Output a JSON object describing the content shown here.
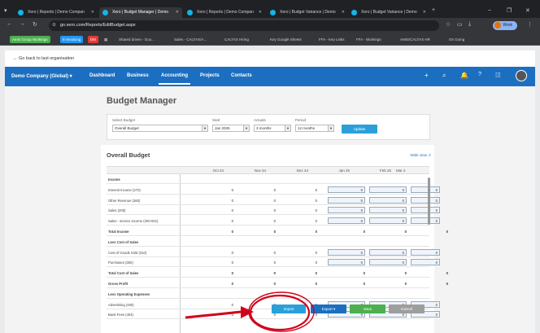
{
  "browser": {
    "tabs": [
      {
        "label": "Xero | Reports | Demo Compan"
      },
      {
        "label": "Xero | Budget Manager | Demo"
      },
      {
        "label": "Xero | Reports | Demo Compan"
      },
      {
        "label": "Xero | Budget Variance | Demo"
      },
      {
        "label": "Xero | Budget Variance | Demo"
      }
    ],
    "new_tab": "+",
    "url": "go.xero.com/Reports/EditBudget.aspx",
    "profile": "Work"
  },
  "bookmarks": [
    {
      "label": "Amis Group Workings"
    },
    {
      "label": "E-Invoicing"
    },
    {
      "label": "DM"
    },
    {
      "label": "Shared drives - Goo..."
    },
    {
      "label": "Sales - CALTAX/A..."
    },
    {
      "label": "CALTAX Hiring"
    },
    {
      "label": "Key Google Sheets"
    },
    {
      "label": "FFA - Key Links"
    },
    {
      "label": "FFA - Workings"
    },
    {
      "label": "AMIS/CALTAX HR"
    },
    {
      "label": "On Going"
    }
  ],
  "back_link": "Go back to last organisation",
  "xero_nav": {
    "org": "Demo Company (Global)",
    "items": [
      "Dashboard",
      "Business",
      "Accounting",
      "Projects",
      "Contacts"
    ],
    "active": "Accounting"
  },
  "page": {
    "title": "Budget Manager",
    "filters": {
      "select_budget_label": "Select Budget",
      "select_budget_value": "Overall Budget",
      "start_label": "Start",
      "start_value": "Jan 2025",
      "actuals_label": "Actuals",
      "actuals_value": "3 months",
      "period_label": "Period",
      "period_value": "12 months",
      "update_label": "Update"
    },
    "grid": {
      "title": "Overall Budget",
      "show_view": "Wide view",
      "columns": [
        "Oct 24",
        "Nov 24",
        "Dec 24",
        "Jan 25",
        "Feb 25",
        "Mar 2"
      ],
      "rows": [
        {
          "label": "Income",
          "type": "header"
        },
        {
          "label": "Interest Income (270)",
          "values": [
            "0",
            "0",
            "0",
            "0",
            "0",
            "0"
          ]
        },
        {
          "label": "Other Revenue (260)",
          "values": [
            "0",
            "0",
            "0",
            "0",
            "0",
            "0"
          ]
        },
        {
          "label": "Sales (200)",
          "values": [
            "0",
            "0",
            "0",
            "0",
            "0",
            "0"
          ]
        },
        {
          "label": "Sales - service income (200-001)",
          "values": [
            "0",
            "0",
            "0",
            "0",
            "0",
            "0"
          ]
        },
        {
          "label": "Total Income",
          "type": "total",
          "values": [
            "0",
            "0",
            "0",
            "0",
            "0",
            "0"
          ]
        },
        {
          "label": "Less Cost of Sales",
          "type": "header"
        },
        {
          "label": "Cost of Goods Sold (310)",
          "values": [
            "0",
            "0",
            "0",
            "0",
            "0",
            "0"
          ]
        },
        {
          "label": "Purchases (300)",
          "values": [
            "0",
            "0",
            "0",
            "0",
            "0",
            "0"
          ]
        },
        {
          "label": "Total Cost of Sales",
          "type": "total",
          "values": [
            "0",
            "0",
            "0",
            "0",
            "0",
            "0"
          ]
        },
        {
          "label": "Gross Profit",
          "type": "total",
          "values": [
            "0",
            "0",
            "0",
            "0",
            "0",
            "0"
          ]
        },
        {
          "label": "Less Operating Expenses",
          "type": "header"
        },
        {
          "label": "Advertising (400)",
          "values": [
            "0",
            "0",
            "0",
            "0",
            "0",
            "0"
          ]
        },
        {
          "label": "Bank Fees (404)",
          "values": [
            "0",
            "0",
            "0",
            "0",
            "0",
            "0"
          ]
        }
      ]
    },
    "actions": {
      "import": "Import",
      "export": "Export",
      "save": "Save",
      "cancel": "Cancel"
    }
  },
  "colors": {
    "xero_blue": "#1c6fc0",
    "update_blue": "#2aa0da",
    "save_green": "#4caf50",
    "annotation_red": "#d0021b"
  }
}
